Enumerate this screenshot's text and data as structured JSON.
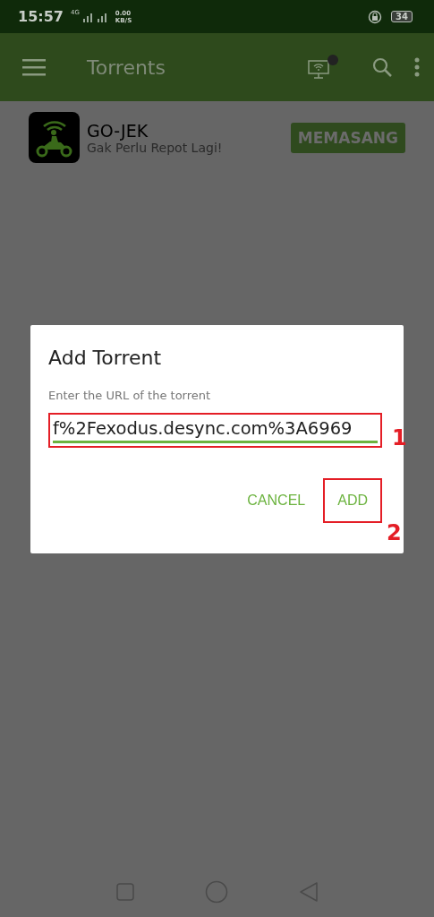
{
  "status_bar": {
    "time": "15:57",
    "network": "4G",
    "speed": "0.00",
    "speed_unit": "KB/S",
    "battery": "34"
  },
  "app_bar": {
    "title": "Torrents",
    "notification_dot": true
  },
  "ad": {
    "name": "GO-JEK",
    "tagline": "Gak Perlu Repot Lagi!",
    "button": "MEMASANG"
  },
  "dialog": {
    "title": "Add Torrent",
    "label": "Enter the URL of the torrent",
    "value": "f%2Fexodus.desync.com%3A6969",
    "focused": true,
    "buttons": [
      {
        "label": "CANCEL",
        "highlighted": false
      },
      {
        "label": "ADD",
        "highlighted": true
      }
    ]
  },
  "annotations": [
    {
      "label": "1"
    },
    {
      "label": "2"
    }
  ]
}
